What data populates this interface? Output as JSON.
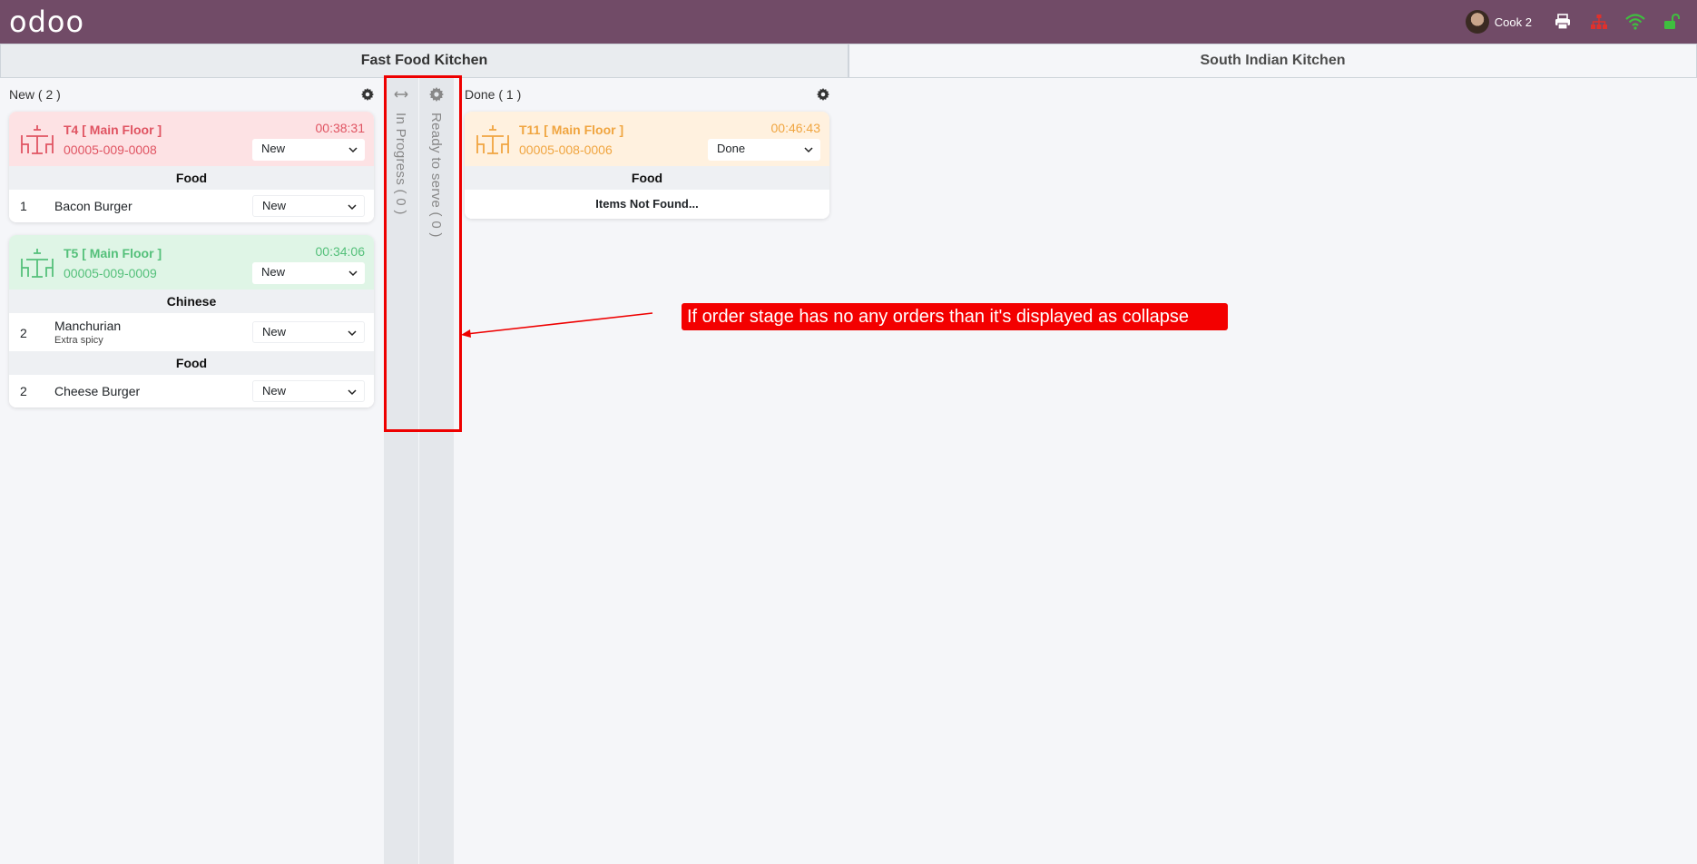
{
  "navbar": {
    "logo": "odoo",
    "user_name": "Cook 2",
    "icons": [
      "avatar",
      "printer-icon",
      "network-icon",
      "wifi-icon",
      "unlock-icon"
    ],
    "colors": {
      "background": "#714b67",
      "network": "#e0312c",
      "wifi": "#3fbf3f",
      "unlock": "#3fbf3f"
    }
  },
  "tabs": [
    {
      "label": "Fast Food Kitchen",
      "active": true
    },
    {
      "label": "South Indian Kitchen",
      "active": false
    }
  ],
  "columns": {
    "new": {
      "title": "New ( 2 )",
      "orders": [
        {
          "table": "T4 [ Main Floor ]",
          "ref": "00005-009-0008",
          "timer": "00:38:31",
          "state": "New",
          "color": "#e05462",
          "groups": [
            {
              "category": "Food",
              "items": [
                {
                  "qty": "1",
                  "name": "Bacon Burger",
                  "note": "",
                  "state": "New"
                }
              ]
            }
          ]
        },
        {
          "table": "T5 [ Main Floor ]",
          "ref": "00005-009-0009",
          "timer": "00:34:06",
          "state": "New",
          "color": "#54c07a",
          "groups": [
            {
              "category": "Chinese",
              "items": [
                {
                  "qty": "2",
                  "name": "Manchurian",
                  "note": "Extra spicy",
                  "state": "New"
                }
              ]
            },
            {
              "category": "Food",
              "items": [
                {
                  "qty": "2",
                  "name": "Cheese Burger",
                  "note": "",
                  "state": "New"
                }
              ]
            }
          ]
        }
      ]
    },
    "in_progress": {
      "title": "In Progress ( 0 )"
    },
    "ready": {
      "title": "Ready to serve ( 0 )"
    },
    "done": {
      "title": "Done ( 1 )",
      "orders": [
        {
          "table": "T11 [ Main Floor ]",
          "ref": "00005-008-0006",
          "timer": "00:46:43",
          "state": "Done",
          "color": "#f0a540",
          "category": "Food",
          "empty_text": "Items Not Found..."
        }
      ]
    }
  },
  "annotation": {
    "text": "If order stage has no any orders than it's displayed as collapse",
    "color": "#f30000"
  }
}
